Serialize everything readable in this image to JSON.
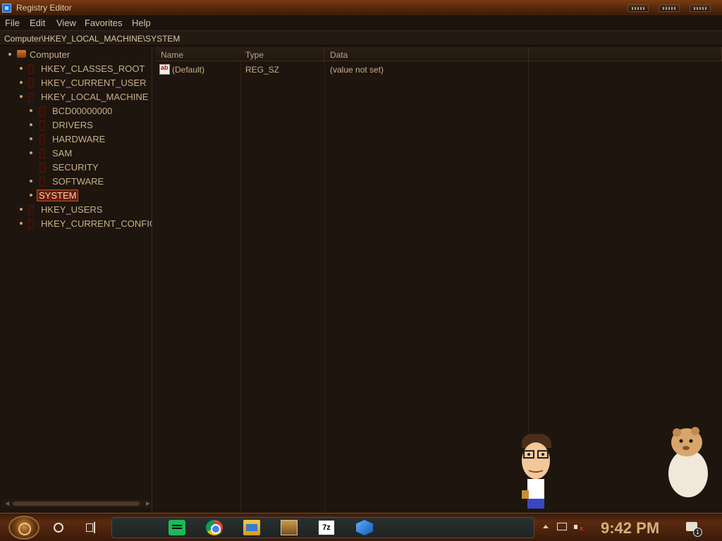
{
  "window": {
    "title": "Registry Editor"
  },
  "menu": [
    "File",
    "Edit",
    "View",
    "Favorites",
    "Help"
  ],
  "address": "Computer\\HKEY_LOCAL_MACHINE\\SYSTEM",
  "tree": {
    "root": "Computer",
    "items": [
      {
        "label": "HKEY_CLASSES_ROOT"
      },
      {
        "label": "HKEY_CURRENT_USER"
      },
      {
        "label": "HKEY_LOCAL_MACHINE"
      },
      {
        "label": "BCD00000000"
      },
      {
        "label": "DRIVERS"
      },
      {
        "label": "HARDWARE"
      },
      {
        "label": "SAM"
      },
      {
        "label": "SECURITY"
      },
      {
        "label": "SOFTWARE"
      },
      {
        "label": "SYSTEM",
        "selected": true
      },
      {
        "label": "HKEY_USERS"
      },
      {
        "label": "HKEY_CURRENT_CONFIG"
      }
    ]
  },
  "values": {
    "columns": [
      "Name",
      "Type",
      "Data"
    ],
    "rows": [
      {
        "name": "(Default)",
        "type": "REG_SZ",
        "data": "(value not set)"
      }
    ]
  },
  "taskbar": {
    "clock": "9:42 PM",
    "notification_count": "1",
    "apps": [
      "spotify-icon",
      "chrome-icon",
      "file-explorer-icon",
      "gamebox-icon",
      "7zip-icon",
      "cubes-icon"
    ],
    "sevenzip_label": "7z"
  }
}
